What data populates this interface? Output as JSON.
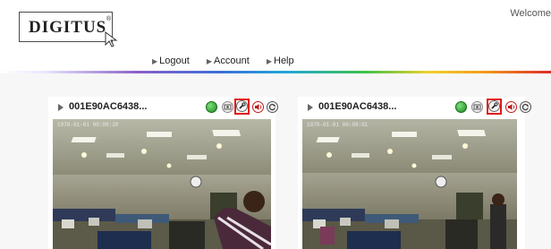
{
  "header": {
    "logo_text": "DIGITUS",
    "logo_mark": "®",
    "welcome": "Welcome"
  },
  "nav": {
    "items": [
      {
        "label": "Logout"
      },
      {
        "label": "Account"
      },
      {
        "label": "Help"
      }
    ]
  },
  "cameras": [
    {
      "name": "001E90AC6438...",
      "timestamp": "1970-01-01 00:08:20"
    },
    {
      "name": "001E90AC6438...",
      "timestamp": "1970-01-01 00:08:01"
    }
  ],
  "icons": {
    "status": "status-led-icon",
    "snapshot": "snapshot-icon",
    "settings": "settings-wrench-icon",
    "audio": "audio-speaker-icon",
    "refresh": "refresh-icon"
  },
  "colors": {
    "status_green": "#2ca02c",
    "highlight_red": "#e01818"
  }
}
